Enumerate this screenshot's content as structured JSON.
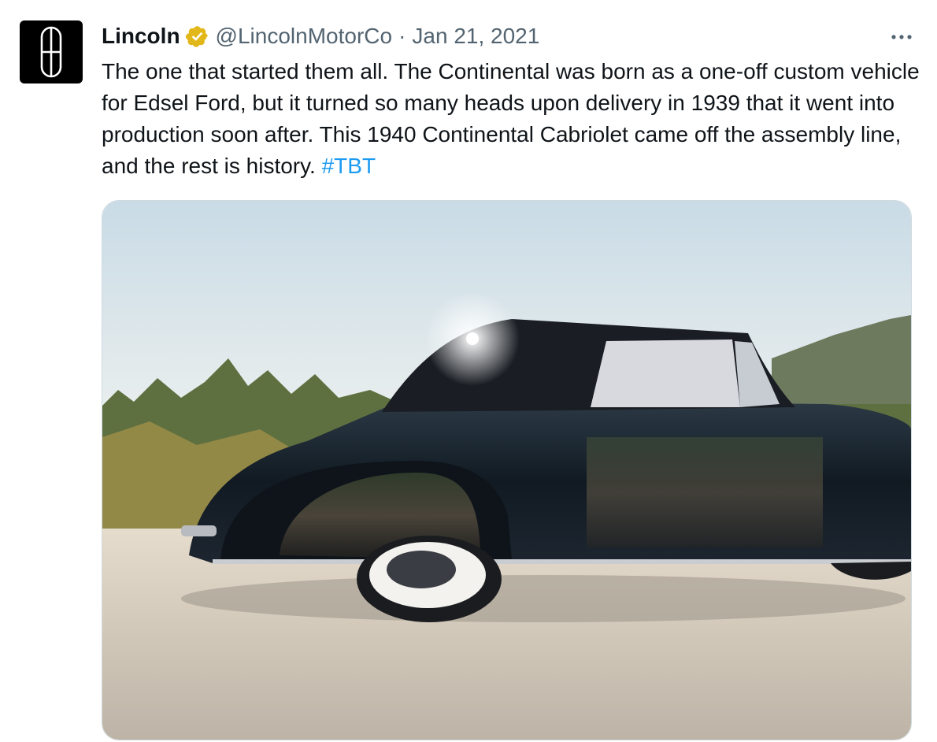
{
  "tweet": {
    "author_name": "Lincoln",
    "handle": "@LincolnMotorCo",
    "separator": "·",
    "date": "Jan 21, 2021",
    "text_before_tag": "The one that started them all. The Continental was born as a one-off custom vehicle for Edsel Ford, but it turned so many heads upon delivery in 1939 that it went into production soon after. This 1940 Continental Cabriolet came off the assembly line, and the rest is history. ",
    "hashtag": "#TBT",
    "verified": true,
    "more_icon": "more-horizontal-icon",
    "media_alt": "Black 1940 Lincoln Continental Cabriolet parked on a sandy lot with trees and mountains behind"
  },
  "colors": {
    "link": "#1d9bf0",
    "secondary_text": "#536471",
    "verified_gold": "#e2b719"
  }
}
